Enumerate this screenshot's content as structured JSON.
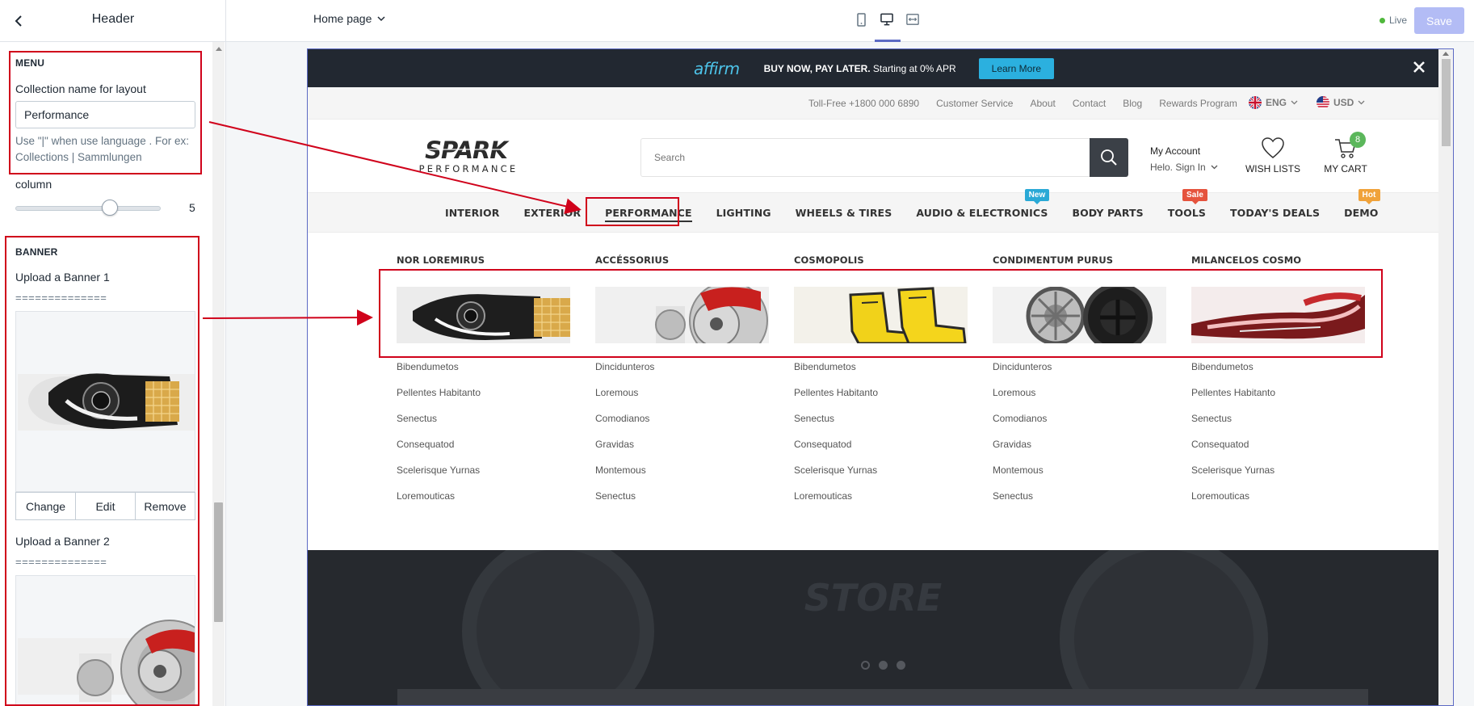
{
  "topbar": {
    "panel_title": "Header",
    "page_select": "Home page",
    "live_label": "Live",
    "save_label": "Save"
  },
  "sidebar": {
    "menu": {
      "title": "MENU",
      "collection_label": "Collection name for layout",
      "collection_value": "Performance",
      "help_text": "Use \"|\" when use language . For ex: Collections | Sammlungen",
      "column_label": "column",
      "column_value": "5"
    },
    "banner": {
      "title": "BANNER",
      "upload1_label": "Upload a Banner 1",
      "divider1": "==============",
      "upload2_label": "Upload a Banner 2",
      "divider2": "==============",
      "actions": [
        "Change",
        "Edit",
        "Remove"
      ]
    }
  },
  "preview": {
    "promo": {
      "brand": "affirm",
      "text_bold": "BUY NOW, PAY LATER.",
      "text_rest": " Starting at 0% APR",
      "button": "Learn More"
    },
    "util_links": [
      "Toll-Free +1800 000 6890",
      "Customer Service",
      "About",
      "Contact",
      "Blog",
      "Rewards Program"
    ],
    "language": "ENG",
    "currency": "USD",
    "logo_text": "SPARK",
    "logo_sub": "PERFORMANCE",
    "search_placeholder": "Search",
    "account": {
      "title": "My Account",
      "sub": "Helo. Sign In"
    },
    "wishlist_label": "WISH LISTS",
    "cart_label": "MY CART",
    "cart_count": "8",
    "nav": [
      {
        "label": "INTERIOR",
        "badge": ""
      },
      {
        "label": "EXTERIOR",
        "badge": ""
      },
      {
        "label": "PERFORMANCE",
        "badge": ""
      },
      {
        "label": "LIGHTING",
        "badge": ""
      },
      {
        "label": "WHEELS & TIRES",
        "badge": ""
      },
      {
        "label": "AUDIO & ELECTRONICS",
        "badge": "New"
      },
      {
        "label": "BODY PARTS",
        "badge": ""
      },
      {
        "label": "TOOLS",
        "badge": "Sale"
      },
      {
        "label": "TODAY'S DEALS",
        "badge": ""
      },
      {
        "label": "DEMO",
        "badge": "Hot"
      }
    ],
    "badge_colors": {
      "New": "#2aa9d6",
      "Sale": "#e5533d",
      "Hot": "#f0a23a"
    },
    "mega_columns": [
      {
        "title": "NOR LOREMIRUS",
        "image": "headlight-image",
        "links": [
          "Bibendumetos",
          "Pellentes Habitanto",
          "Senectus",
          "Consequatod",
          "Scelerisque Yurnas",
          "Loremouticas"
        ]
      },
      {
        "title": "ACCÉSSORIUS",
        "image": "brake-image",
        "links": [
          "Dincidunteros",
          "Loremous",
          "Comodianos",
          "Gravidas",
          "Montemous",
          "Senectus"
        ]
      },
      {
        "title": "COSMOPOLIS",
        "image": "seats-image",
        "links": [
          "Bibendumetos",
          "Pellentes Habitanto",
          "Senectus",
          "Consequatod",
          "Scelerisque Yurnas",
          "Loremouticas"
        ]
      },
      {
        "title": "CONDIMENTUM PURUS",
        "image": "wheel-image",
        "links": [
          "Dincidunteros",
          "Loremous",
          "Comodianos",
          "Gravidas",
          "Montemous",
          "Senectus"
        ]
      },
      {
        "title": "MILANCELOS COSMO",
        "image": "taillight-image",
        "links": [
          "Bibendumetos",
          "Pellentes Habitanto",
          "Senectus",
          "Consequatod",
          "Scelerisque Yurnas",
          "Loremouticas"
        ]
      }
    ]
  }
}
